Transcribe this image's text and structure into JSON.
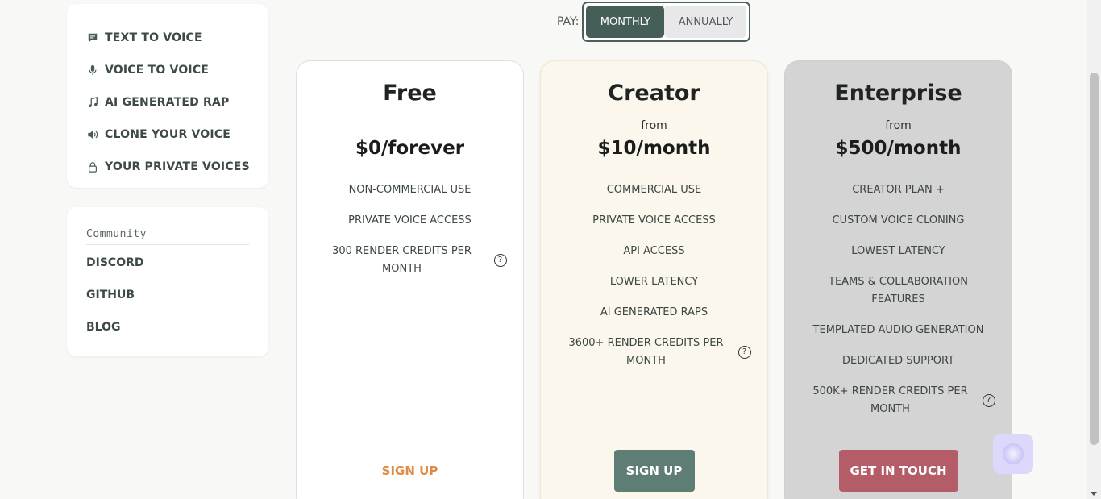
{
  "sidebar": {
    "menu": [
      {
        "label": "TEXT TO VOICE",
        "icon": "chat-bubble-icon"
      },
      {
        "label": "VOICE TO VOICE",
        "icon": "microphone-icon"
      },
      {
        "label": "AI GENERATED RAP",
        "icon": "music-note-icon"
      },
      {
        "label": "CLONE YOUR VOICE",
        "icon": "speaker-icon"
      },
      {
        "label": "YOUR PRIVATE VOICES",
        "icon": "lock-icon"
      }
    ],
    "community": {
      "title": "Community",
      "links": [
        "DISCORD",
        "GITHUB",
        "BLOG"
      ]
    }
  },
  "billing": {
    "pay_label": "PAY:",
    "options": [
      "MONTHLY",
      "ANNUALLY"
    ],
    "selected": "MONTHLY"
  },
  "plans": [
    {
      "name": "Free",
      "from": "",
      "price": "$0/forever",
      "features": [
        "NON-COMMERCIAL USE",
        "PRIVATE VOICE ACCESS",
        "300 RENDER CREDITS PER MONTH"
      ],
      "cta": "SIGN UP"
    },
    {
      "name": "Creator",
      "from": "from",
      "price": "$10/month",
      "features": [
        "COMMERCIAL USE",
        "PRIVATE VOICE ACCESS",
        "API ACCESS",
        "LOWER LATENCY",
        "AI GENERATED RAPS",
        "3600+ RENDER CREDITS PER MONTH"
      ],
      "cta": "SIGN UP"
    },
    {
      "name": "Enterprise",
      "from": "from",
      "price": "$500/month",
      "features": [
        "CREATOR PLAN +",
        "CUSTOM VOICE CLONING",
        "LOWEST LATENCY",
        "TEAMS & COLLABORATION FEATURES",
        "TEMPLATED AUDIO GENERATION",
        "DEDICATED SUPPORT",
        "500K+ RENDER CREDITS PER MONTH"
      ],
      "cta": "GET IN TOUCH"
    }
  ],
  "help_glyph": "?",
  "colors": {
    "accent": "#465e58",
    "creator_cta": "#5e7d74",
    "enterprise_cta": "#b45d68",
    "free_cta": "#e08a45"
  }
}
